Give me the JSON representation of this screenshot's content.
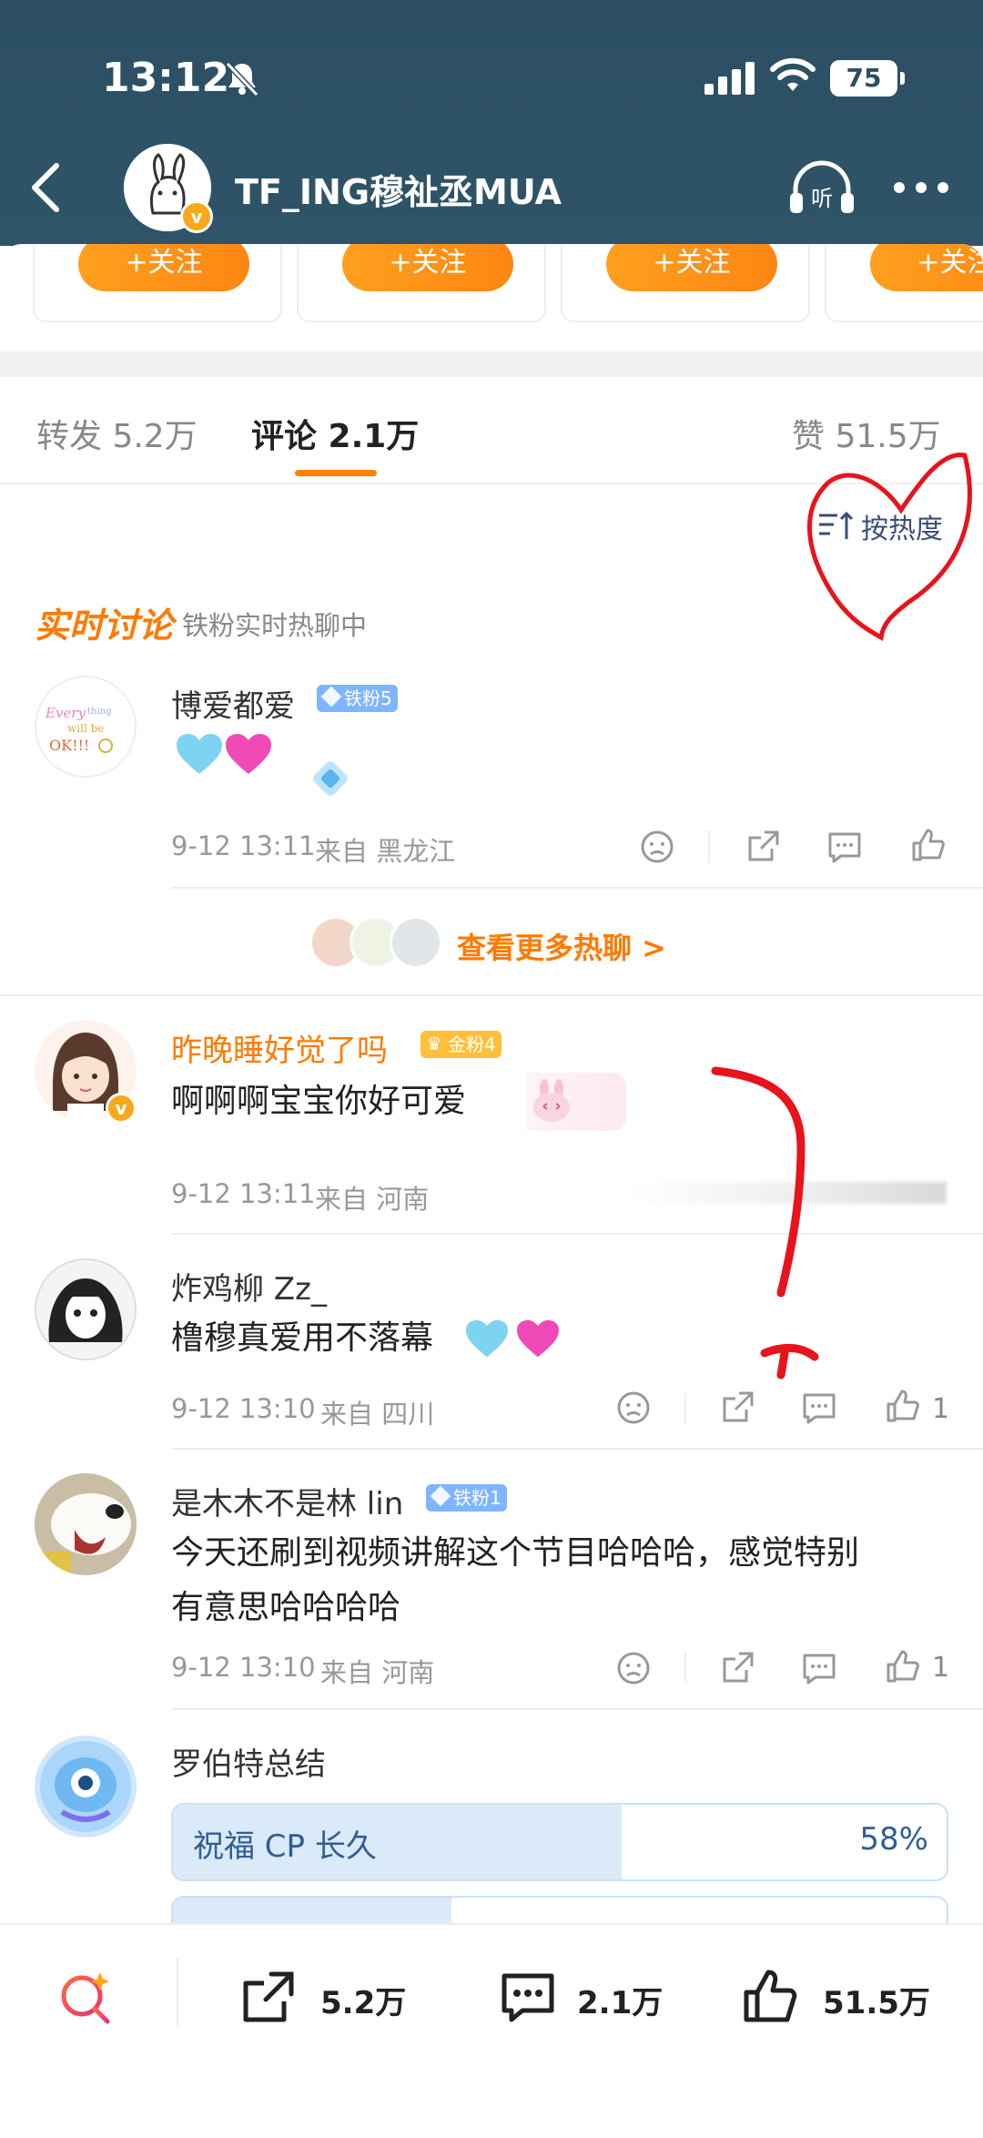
{
  "status_bar": {
    "time": "13:12",
    "battery": "75"
  },
  "header": {
    "title": "TF_ING穆祉丞MUA",
    "verified_badge": "v"
  },
  "follow_cards": {
    "follow_label": "+关注",
    "count_visible": 4
  },
  "tabs": {
    "repost": "转发 5.2万",
    "comments": "评论 2.1万",
    "likes": "赞 51.5万"
  },
  "sort": {
    "label": "按热度"
  },
  "live_discussion": {
    "title": "实时讨论",
    "subtitle": "铁粉实时热聊中",
    "comment": {
      "username": "博爱都爱",
      "badge": "铁粉5",
      "avatar_text": "Everything will be OK!!!",
      "time": "9-12 13:11",
      "location": "来自 黑龙江"
    },
    "more_label": "查看更多热聊 >"
  },
  "comments": [
    {
      "username": "昨晚睡好觉了吗",
      "badge": "金粉4",
      "text": "啊啊啊宝宝你好可爱",
      "time": "9-12 13:11",
      "location": "来自 河南"
    },
    {
      "username": "炸鸡柳 Zz_",
      "text": "橹穆真爱用不落幕",
      "time": "9-12 13:10",
      "location": "来自 四川",
      "likes": "1"
    },
    {
      "username": "是木木不是林 lin",
      "badge": "铁粉1",
      "text_line1": "今天还刷到视频讲解这个节目哈哈哈，感觉特别",
      "text_line2": "有意思哈哈哈哈",
      "time": "9-12 13:10",
      "location": "来自 河南",
      "likes": "1"
    },
    {
      "username": "罗伯特总结",
      "poll": [
        {
          "label": "祝福 CP 长久",
          "percent": "58%",
          "fraction": 0.58
        }
      ]
    }
  ],
  "bottom_bar": {
    "reposts": "5.2万",
    "comments": "2.1万",
    "likes": "51.5万"
  },
  "colors": {
    "header_bg": "#2c4f62",
    "accent_orange": "#ff8200",
    "annotation_red": "#e8131b"
  }
}
